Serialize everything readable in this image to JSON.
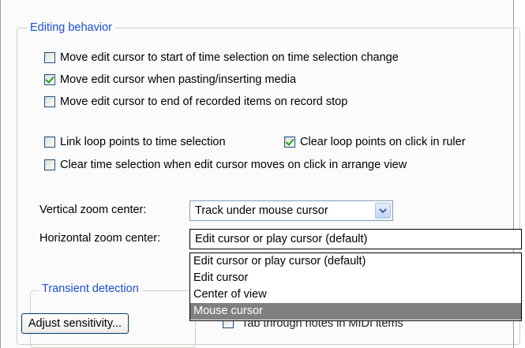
{
  "editing_behavior": {
    "title": "Editing behavior",
    "checkboxes": [
      {
        "label": "Move edit cursor to start of time selection on time selection change",
        "checked": false
      },
      {
        "label": "Move edit cursor when pasting/inserting media",
        "checked": true
      },
      {
        "label": "Move edit cursor to end of recorded items on record stop",
        "checked": false
      },
      {
        "label": "Link loop points to time selection",
        "checked": false
      },
      {
        "label": "Clear loop points on click in ruler",
        "checked": true
      },
      {
        "label": "Clear time selection when edit cursor moves on click in arrange view",
        "checked": false
      }
    ],
    "vertical_zoom": {
      "label": "Vertical zoom center:",
      "value": "Track under mouse cursor"
    },
    "horizontal_zoom": {
      "label": "Horizontal zoom center:",
      "value": "Edit cursor or play cursor (default)",
      "options": [
        "Edit cursor or play cursor (default)",
        "Edit cursor",
        "Center of view",
        "Mouse cursor"
      ],
      "highlighted": "Mouse cursor"
    }
  },
  "transient_detection": {
    "title": "Transient detection",
    "adjust_button": "Adjust sensitivity...",
    "obscured_checkbox_label": "Tab through notes in MIDI items"
  },
  "icons": {
    "dropdown_arrow": "chevron-down-icon",
    "check": "checkmark-icon"
  },
  "colors": {
    "group_title": "#1a4fd0",
    "check": "#21a121",
    "highlight": "#808080"
  }
}
